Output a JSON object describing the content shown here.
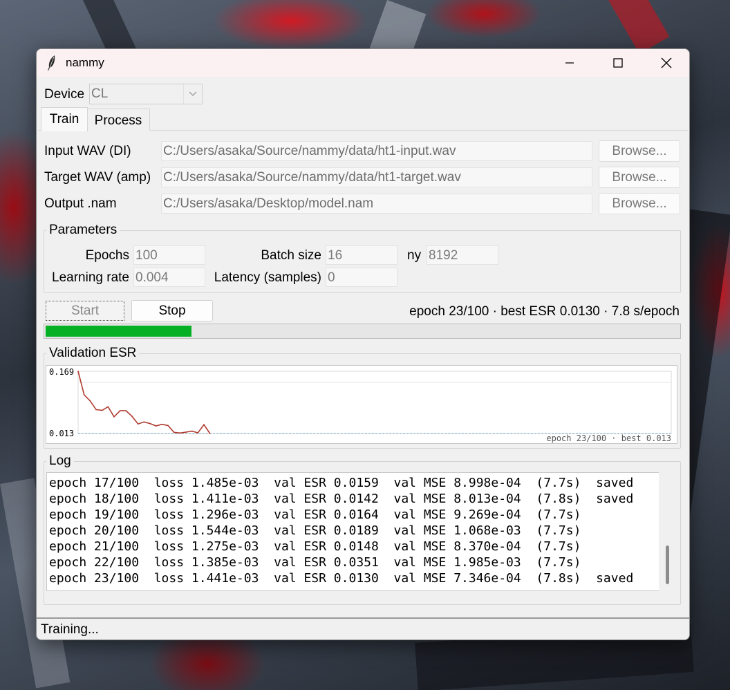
{
  "window": {
    "title": "nammy",
    "controls": {
      "minimize": "minimize-icon",
      "maximize": "maximize-icon",
      "close": "close-icon"
    }
  },
  "device": {
    "label": "Device",
    "value": "CL"
  },
  "tabs": [
    {
      "label": "Train",
      "active": true
    },
    {
      "label": "Process",
      "active": false
    }
  ],
  "files": [
    {
      "label": "Input WAV (DI)",
      "path": "C:/Users/asaka/Source/nammy/data/ht1-input.wav",
      "button": "Browse..."
    },
    {
      "label": "Target WAV (amp)",
      "path": "C:/Users/asaka/Source/nammy/data/ht1-target.wav",
      "button": "Browse..."
    },
    {
      "label": "Output .nam",
      "path": "C:/Users/asaka/Desktop/model.nam",
      "button": "Browse..."
    }
  ],
  "parameters": {
    "title": "Parameters",
    "epochs": {
      "label": "Epochs",
      "value": "100"
    },
    "batch_size": {
      "label": "Batch size",
      "value": "16"
    },
    "ny": {
      "label": "ny",
      "value": "8192"
    },
    "learning_rate": {
      "label": "Learning rate",
      "value": "0.004"
    },
    "latency": {
      "label": "Latency (samples)",
      "value": "0"
    }
  },
  "controls": {
    "start": "Start",
    "stop": "Stop",
    "status": "epoch 23/100 · best ESR 0.0130 · 7.8 s/epoch"
  },
  "progress": {
    "value": 0.23,
    "color": "#06b025"
  },
  "chart_data": {
    "type": "line",
    "title": "Validation ESR",
    "ymax_label": "0.169",
    "ymin_label": "0.013",
    "footer": "epoch 23/100 · best 0.013",
    "ylim": [
      0.013,
      0.169
    ],
    "x_total": 100,
    "best": 0.013,
    "color": "#b03a2e",
    "x": [
      1,
      2,
      3,
      4,
      5,
      6,
      7,
      8,
      9,
      10,
      11,
      12,
      13,
      14,
      15,
      16,
      17,
      18,
      19,
      20,
      21,
      22,
      23
    ],
    "values": [
      0.169,
      0.11,
      0.095,
      0.073,
      0.071,
      0.08,
      0.055,
      0.07,
      0.07,
      0.056,
      0.037,
      0.042,
      0.038,
      0.032,
      0.036,
      0.033,
      0.0159,
      0.0142,
      0.0164,
      0.0189,
      0.0148,
      0.0351,
      0.013
    ]
  },
  "log": {
    "title": "Log",
    "lines": [
      "epoch 17/100  loss 1.485e-03  val ESR 0.0159  val MSE 8.998e-04  (7.7s)  saved",
      "epoch 18/100  loss 1.411e-03  val ESR 0.0142  val MSE 8.013e-04  (7.8s)  saved",
      "epoch 19/100  loss 1.296e-03  val ESR 0.0164  val MSE 9.269e-04  (7.7s)",
      "epoch 20/100  loss 1.544e-03  val ESR 0.0189  val MSE 1.068e-03  (7.7s)",
      "epoch 21/100  loss 1.275e-03  val ESR 0.0148  val MSE 8.370e-04  (7.7s)",
      "epoch 22/100  loss 1.385e-03  val ESR 0.0351  val MSE 1.985e-03  (7.7s)",
      "epoch 23/100  loss 1.441e-03  val ESR 0.0130  val MSE 7.346e-04  (7.8s)  saved"
    ]
  },
  "statusbar": "Training..."
}
